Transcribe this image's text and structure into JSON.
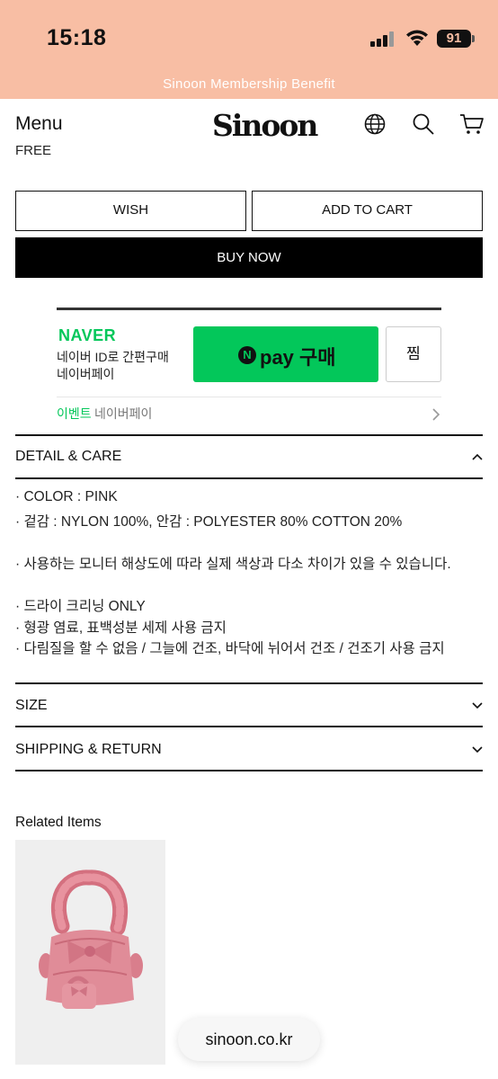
{
  "status_bar": {
    "time": "15:18",
    "battery": "91"
  },
  "promo_bar": {
    "text": "Sinoon Membership Benefit"
  },
  "header": {
    "menu_label": "Menu",
    "logo_text": "Sinoon"
  },
  "product": {
    "shipping_fee": "FREE",
    "wish_label": "WISH",
    "add_to_cart_label": "ADD TO CART",
    "buy_now_label": "BUY NOW"
  },
  "naver_pay": {
    "brand": "NAVER",
    "line1": "네이버 ID로 간편구매",
    "line2": "네이버페이",
    "pay_n": "N",
    "pay_label": "pay 구매",
    "jjim_label": "찜",
    "event_label": "이벤트",
    "event_sub": "네이버페이"
  },
  "accordions": {
    "detail_title": "DETAIL & CARE",
    "size_title": "SIZE",
    "shipping_title": "SHIPPING & RETURN"
  },
  "detail_lines": [
    "· COLOR : PINK",
    "· 겉감 : NYLON 100%, 안감 : POLYESTER 80% COTTON 20%",
    "· 사용하는 모니터 해상도에 따라 실제 색상과 다소 차이가 있을 수 있습니다.",
    "· 드라이 크리닝 ONLY",
    "· 형광 염료, 표백성분 세제 사용 금지",
    "· 다림질을 할 수 없음 / 그늘에 건조, 바닥에 뉘어서 건조 / 건조기 사용 금지"
  ],
  "related": {
    "title": "Related Items"
  },
  "browser": {
    "url": "sinoon.co.kr"
  },
  "colors": {
    "status_bg": "#f8bea4",
    "naver_green": "#03c75a",
    "button_black": "#000000"
  },
  "icons": [
    "globe-icon",
    "search-icon",
    "cart-icon",
    "chevron-up-icon",
    "chevron-down-icon",
    "chevron-right-icon"
  ]
}
